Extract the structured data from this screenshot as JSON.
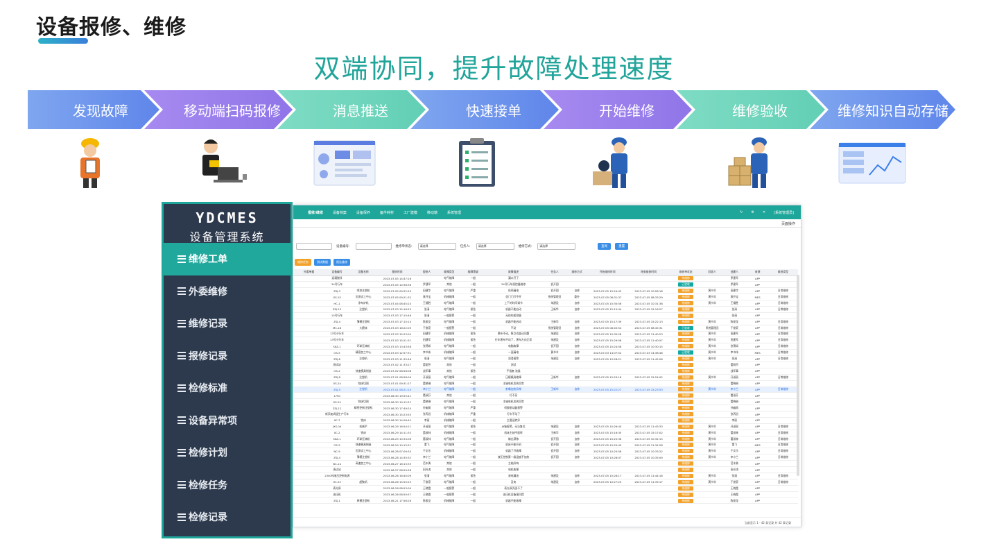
{
  "page": {
    "title": "设备报修、维修",
    "subtitle": "双端协同，提升故障处理速度",
    "accent_color": "#21a49a"
  },
  "steps": [
    {
      "label": "发现故障",
      "icon": "worker-clipboard-icon"
    },
    {
      "label": "移动端扫码报修",
      "icon": "man-laptop-icon"
    },
    {
      "label": "消息推送",
      "icon": "message-dashboard-icon"
    },
    {
      "label": "快速接单",
      "icon": "checklist-icon"
    },
    {
      "label": "开始维修",
      "icon": "repair-worker-icon"
    },
    {
      "label": "维修验收",
      "icon": "worker-boxes-icon"
    },
    {
      "label": "维修知识自动存储",
      "icon": "analytics-screen-icon"
    }
  ],
  "sidebar": {
    "logo_en": "YDCMES",
    "logo_cn": "设备管理系统",
    "items": [
      {
        "label": "维修工单",
        "active": true
      },
      {
        "label": "外委维修"
      },
      {
        "label": "维修记录"
      },
      {
        "label": "报修记录"
      },
      {
        "label": "检修标准"
      },
      {
        "label": "设备异常项"
      },
      {
        "label": "检修计划"
      },
      {
        "label": "检修任务"
      },
      {
        "label": "检修记录"
      }
    ]
  },
  "app": {
    "nav": [
      "报修/维修",
      "设备档案",
      "设备保养",
      "备件耗材",
      "工厂建模",
      "移动端",
      "系统管理"
    ],
    "user": "[系统管理员]",
    "page_ops": "页面操作",
    "filters": {
      "device_code": "设备编号:",
      "repair_status": "维修单状态:",
      "assignee": "任务人:",
      "repair_method": "维修方式:",
      "select_placeholder": "请选择",
      "query": "查询",
      "reset": "重置"
    },
    "actions": [
      "维修任务",
      "测试数据",
      "报告维修"
    ],
    "columns": [
      "外委单据",
      "设备编号",
      "设备名称",
      "报修时间",
      "报修人",
      "故障类型",
      "故障等级",
      "故障描述",
      "任务人",
      "维修方式",
      "开始维修时间",
      "结束维修时间",
      "维修单状态",
      "验收人",
      "创建人",
      "来源",
      "维修类型"
    ],
    "rows": [
      [
        "",
        "混凝搅拌",
        "",
        "2023-07-05 14:47:16",
        "",
        "电气故障",
        "一般",
        "漏水开了",
        "",
        "",
        "",
        "",
        "待维修",
        "",
        "罗建军",
        "APP",
        ""
      ],
      [
        "",
        "34号行车",
        "",
        "2023-07-05 10:36:36",
        "罗建军",
        "其他",
        "一般",
        "34号行车遥控器维修",
        "侦开国",
        "",
        "",
        "",
        "已验收",
        "",
        "罗建军",
        "APP",
        ""
      ],
      [
        "",
        "ZSJ-3",
        "喷漆注塑机",
        "2023-07-05 09:52:59",
        "田建华",
        "电气故障",
        "严重",
        "机壳漏电",
        "侦开国",
        "自修",
        "2023-07-05 10:24:42",
        "2023-07-05 10:28:18",
        "待维修",
        "黄书羊",
        "田建华",
        "APP",
        "日常维修"
      ],
      [
        "",
        "OS-15",
        "压测试工中心",
        "2023-07-05 09:21:32",
        "袁开宝",
        "机械故障",
        "一般",
        "坐门门打不开",
        "系统管理员",
        "委外",
        "2023-07-05 08:31:37",
        "2023-07-05 08:33:29",
        "待维修",
        "黄书羊",
        "袁开宝",
        "MES",
        "日常维修"
      ],
      [
        "",
        "HC-1",
        "涂布炉机",
        "2023-07-04 08:45:24",
        "王福胜",
        "电气故障",
        "一般",
        "上下的时间调节",
        "朱建设",
        "自修",
        "2023-07-05 10:30:56",
        "2023-07-05 10:31:38",
        "待维修",
        "黄书羊",
        "王福胜",
        "APP",
        "日常维修"
      ],
      [
        "",
        "ZSJ-10",
        "注塑机",
        "2023-07-03 15:16:53",
        "张清",
        "电气故障",
        "紧急",
        "机器不能启动",
        "王新华",
        "自修",
        "2023-07-05 15:15:44",
        "2023-07-05 15:16:27",
        "待维修",
        "",
        "张清",
        "APP",
        "日常维修"
      ],
      [
        "",
        "15号行车",
        "",
        "2023-07-03 17:15:46",
        "张清",
        "一般报警",
        "一般",
        "无线的遥控器",
        "",
        "",
        "",
        "",
        "待维修",
        "",
        "张清",
        "APP",
        ""
      ],
      [
        "",
        "ZSJ-4",
        "薄模注塑机",
        "2023-07-03 17:15:14",
        "陈俊龙",
        "电气故障",
        "一般",
        "机器不能启动",
        "王新华",
        "自修",
        "2023-07-05 15:17:39",
        "2023-07-05 15:22:13",
        "待维修",
        "黄书羊",
        "陈俊龙",
        "APP",
        "日常维修"
      ],
      [
        "",
        "MC-18",
        "大磨床",
        "2023-07-03 16:22:05",
        "于俊豪",
        "一般报警",
        "一般",
        "不动",
        "系统管理员",
        "自修",
        "2023-07-05 08:45:54",
        "2023-07-05 08:45:31",
        "已验收",
        "系统管理员",
        "于俊豪",
        "APP",
        "日常维修"
      ],
      [
        "",
        "13号小行车",
        "",
        "2023-07-03 15:23:04",
        "田建军",
        "机械故障",
        "紧急",
        "黑布不动，断点也变动问题",
        "朱建设",
        "自修",
        "2023-07-05 10:35:28",
        "2023-07-05 11:40:23",
        "待维修",
        "黄书羊",
        "田建军",
        "APP",
        "日常维修"
      ],
      [
        "",
        "13号小行车",
        "",
        "2023-07-03 15:21:31",
        "田建军",
        "机械故障",
        "紧急",
        "行车黑布不动了，黑布方向正常",
        "朱建设",
        "自修",
        "2023-07-05 10:29:58",
        "2023-07-05 11:40:57",
        "待维修",
        "黄书羊",
        "田建军",
        "APP",
        "日常维修"
      ],
      [
        "",
        "SKZ-1",
        "环球压铸机",
        "2023-07-03 13:43:58",
        "张锦如",
        "电气故障",
        "一般",
        "电脑故障",
        "侦开国",
        "自修",
        "2023-07-05 10:24:58",
        "2023-07-05 10:30:15",
        "待维修",
        "黄书羊",
        "张锦如",
        "APP",
        "日常维修"
      ],
      [
        "",
        "OS-5",
        "精密加工中心",
        "2023-07-03 12:57:31",
        "李书伟",
        "机械故障",
        "一般",
        "一面漏电",
        "黄书羊",
        "自修",
        "2023-07-03 14:07:52",
        "2023-07-03 14:38:46",
        "已验收",
        "黄书羊",
        "李书伟",
        "MES",
        "日常维修"
      ],
      [
        "",
        "ZSJ-8",
        "注塑机",
        "2023-07-03 11:35:46",
        "张清",
        "电气故障",
        "一般",
        "润滑报警",
        "朱建设",
        "自修",
        "2023-07-05 10:28:21",
        "2023-07-05 11:42:06",
        "待维修",
        "黄书羊",
        "张清",
        "APP",
        "日常维修"
      ],
      [
        "",
        "测试站",
        "",
        "2023-07-02 11:33:27",
        "蕾丽莎",
        "其他",
        "一般",
        "测试",
        "",
        "",
        "",
        "",
        "待维修",
        "",
        "蕾丽莎",
        "APP",
        ""
      ],
      [
        "",
        "OS-2",
        "快速模具制造",
        "2023-07-02 08:56:08",
        "战军事",
        "其他",
        "紧急",
        "手指套 流量",
        "",
        "",
        "",
        "",
        "待维修",
        "",
        "战军事",
        "APP",
        ""
      ],
      [
        "",
        "ZSJ-8",
        "注塑机",
        "2023-07-01 08:58:09",
        "开淑丽",
        "电气故障",
        "一般",
        "压模模具故障",
        "王新华",
        "自修",
        "2023-07-05 15:23:18",
        "2023-07-05 15:24:02",
        "待维修",
        "黄书羊",
        "开淑丽",
        "APP",
        "日常维修"
      ],
      [
        "",
        "OS-24",
        "铣床切割",
        "2023-07-01 09:31:27",
        "蕾晓琳",
        "电气故障",
        "一般",
        "主轴电机发热异常",
        "",
        "",
        "",
        "",
        "待维修",
        "",
        "蕾晓琳",
        "APP",
        ""
      ],
      [
        "",
        "ZSJ-5",
        "注塑机",
        "2023-07-01 08:21:15",
        "李小兰",
        "电气故障",
        "一般",
        "射嘴加热异常",
        "王新华",
        "自修",
        "2023-07-05 15:22:27",
        "2023-07-05 15:23:53",
        "待维修",
        "黄书羊",
        "李小兰",
        "APP",
        "日常维修"
      ],
      [
        "",
        "1750",
        "",
        "2023-06-30 19:55:41",
        "蕾淑芬",
        "其他",
        "一般",
        "灯不亮",
        "",
        "",
        "",
        "",
        "待维修",
        "",
        "蕾淑芬",
        "APP",
        ""
      ],
      [
        "",
        "OS-24",
        "铣床切割",
        "2023-06-30 19:12:51",
        "蕾晓琳",
        "电气故障",
        "一般",
        "主轴电机发热异常",
        "",
        "",
        "",
        "",
        "待维修",
        "",
        "蕾晓琳",
        "APP",
        ""
      ],
      [
        "",
        "ZSJ-12",
        "精密控制注塑机",
        "2023-06-30 17:49:24",
        "孙幽丽",
        "电气故障",
        "严重",
        "伺服驱动器报警",
        "",
        "",
        "",
        "",
        "待维修",
        "",
        "孙幽丽",
        "APP",
        ""
      ],
      [
        "",
        "新添加调温生产行车",
        "",
        "2023-06-30 15:23:55",
        "张丙旨",
        "机械故障",
        "严重",
        "行车不动了",
        "",
        "",
        "",
        "",
        "待维修",
        "",
        "张丙旨",
        "APP",
        ""
      ],
      [
        "",
        "XC-7",
        "铣床",
        "2023-06-30 14:06:42",
        "李丽",
        "机械故障",
        "一般",
        "主要运转异",
        "",
        "",
        "",
        "",
        "待维修",
        "",
        "李丽",
        "APP",
        ""
      ],
      [
        "",
        "JXS-04",
        "机械手",
        "2023-06-29 16:54:21",
        "开淑丽",
        "电气故障",
        "紧急",
        "J6轴报警，无法复位",
        "朱建设",
        "自修",
        "2023-07-05 10:26:40",
        "2023-07-05 11:43:33",
        "待维修",
        "黄书羊",
        "开淑丽",
        "APP",
        "日常维修"
      ],
      [
        "",
        "XC-2",
        "铣床",
        "2023-06-29 14:11:33",
        "蕾淑林",
        "机械故障",
        "一般",
        "机床主轴不旋转",
        "王新华",
        "自修",
        "2023-07-05 15:16:35",
        "2023-07-05 15:17:02",
        "待维修",
        "黄书羊",
        "蕾淑林",
        "APP",
        "日常维修"
      ],
      [
        "",
        "SKZ-1",
        "环球压铸机",
        "2023-06-29 10:34:06",
        "蕾淑林",
        "电气故障",
        "一般",
        "输出漂移",
        "侦开国",
        "自修",
        "2023-07-05 10:25:36",
        "2023-07-05 10:32:15",
        "待维修",
        "黄书羊",
        "蕾淑林",
        "APP",
        "日常维修"
      ],
      [
        "",
        "OS-5",
        "快速模具制造",
        "2023-06-29 10:15:51",
        "董飞",
        "电气故障",
        "一般",
        "机床不能开机",
        "侦开国",
        "自修",
        "2023-07-05 10:25:45",
        "2023-07-05 11:34:28",
        "待维修",
        "黄书羊",
        "董飞",
        "MES",
        "日常维修"
      ],
      [
        "",
        "NC-9",
        "压测试工中心",
        "2023-06-28 07:09:34",
        "于文乐",
        "机械故障",
        "一般",
        "机器了开故障",
        "侦开国",
        "自修",
        "2023-07-05 10:25:56",
        "2023-07-05 10:33:22",
        "待维修",
        "黄书羊",
        "于文乐",
        "APP",
        "日常维修"
      ],
      [
        "",
        "ZSJ-4",
        "薄模注塑机",
        "2023-06-28 14:35:32",
        "李小兰",
        "电气故障",
        "一般",
        "液压控制第一级温度不加热",
        "侦开国",
        "自修",
        "2023-07-05 10:26:07",
        "2023-07-05 10:35:09",
        "待维修",
        "黄书羊",
        "李小兰",
        "APP",
        "日常维修"
      ],
      [
        "",
        "NC-14",
        "高速加工中心",
        "2023-06-27 16:15:33",
        "范丰勇",
        "其他",
        "一般",
        "主轴异响",
        "",
        "",
        "",
        "",
        "待维修",
        "",
        "范丰勇",
        "APP",
        ""
      ],
      [
        "",
        "清洁站",
        "",
        "2023-06-27 08:59:58",
        "田光涛",
        "其他",
        "一般",
        "电机故障",
        "",
        "",
        "",
        "",
        "待维修",
        "",
        "田光涛",
        "APP",
        ""
      ],
      [
        "",
        "2300吨液压控制电源",
        "",
        "2023-06-26 16:40:09",
        "张清",
        "电气故障",
        "紧急",
        "液电漏油",
        "朱建设",
        "自修",
        "2023-07-05 10:26:17",
        "2023-07-05 11:44:16",
        "待维修",
        "黄书羊",
        "张清",
        "APP",
        "日常维修"
      ],
      [
        "",
        "HC-32",
        "超聚机",
        "2023-06-26 15:55:25",
        "于俊豪",
        "电气故障",
        "一般",
        "没电",
        "朱建设",
        "自修",
        "2023-07-05 10:27:25",
        "2023-07-05 11:39:17",
        "待维修",
        "黄书羊",
        "于俊豪",
        "APP",
        "日常维修"
      ],
      [
        "",
        "表光厚",
        "",
        "2023-06-26 08:53:09",
        "王晓霞",
        "一般报警",
        "一般",
        "表光厚页面不了",
        "",
        "",
        "",
        "",
        "待维修",
        "",
        "王晓霞",
        "APP",
        ""
      ],
      [
        "",
        "油压机",
        "",
        "2023-06-26 08:50:57",
        "王晓霞",
        "一般报警",
        "一般",
        "油压机设备报问提",
        "",
        "",
        "",
        "",
        "待维修",
        "",
        "王晓霞",
        "APP",
        ""
      ],
      [
        "",
        "ZSJ-1",
        "原模注塑机",
        "2023-06-21 17:56:26",
        "陈俊龙",
        "机械故障",
        "一般",
        "机器不能故障",
        "",
        "",
        "",
        "",
        "待维修",
        "",
        "陈俊龙",
        "APP",
        ""
      ]
    ],
    "footer": "当前显示 1 - 42 条记录 共 42 条记录"
  }
}
